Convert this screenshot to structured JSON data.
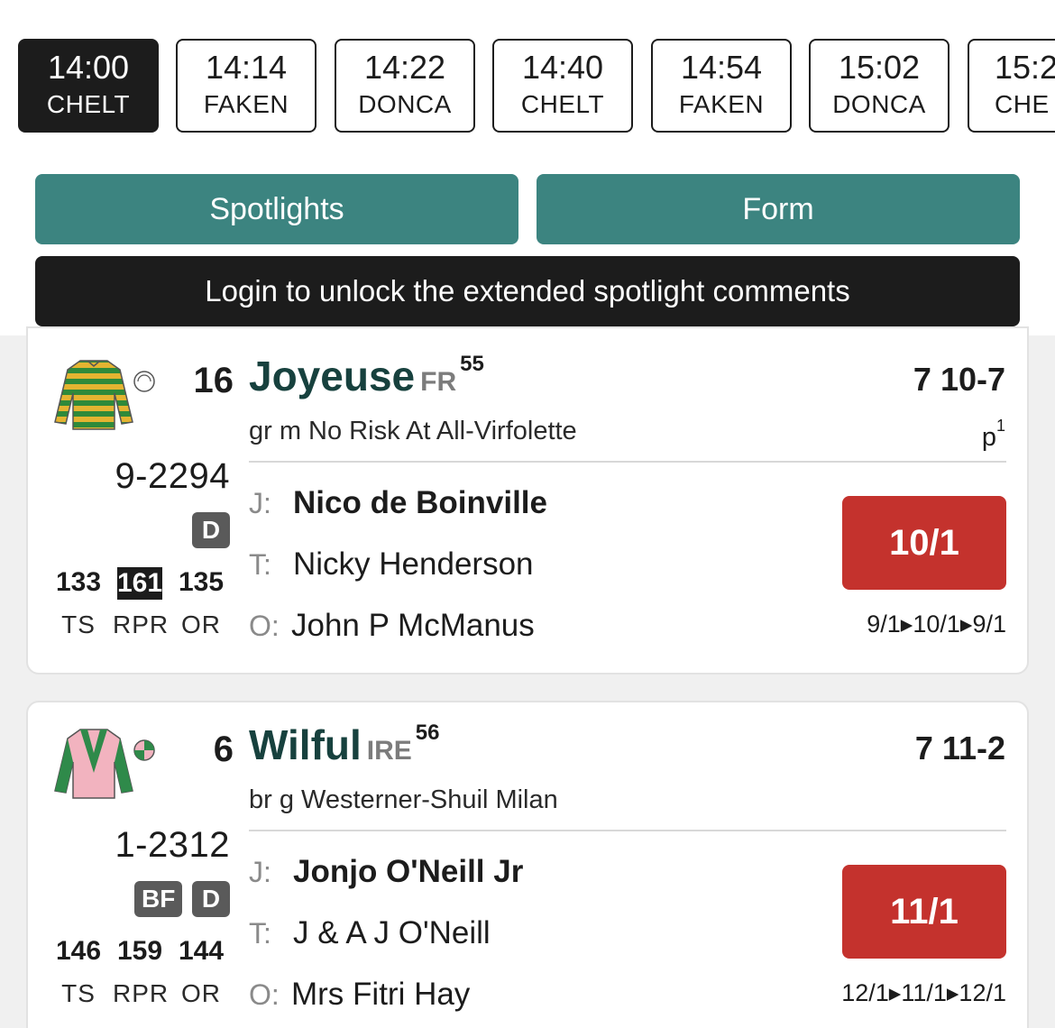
{
  "races": [
    {
      "time": "14:00",
      "course": "CHELT",
      "active": true
    },
    {
      "time": "14:14",
      "course": "FAKEN"
    },
    {
      "time": "14:22",
      "course": "DONCA"
    },
    {
      "time": "14:40",
      "course": "CHELT"
    },
    {
      "time": "14:54",
      "course": "FAKEN"
    },
    {
      "time": "15:02",
      "course": "DONCA"
    },
    {
      "time": "15:2",
      "course": "CHE"
    }
  ],
  "tabs": {
    "spotlights": "Spotlights",
    "form": "Form"
  },
  "login_banner": "Login to unlock the extended spotlight comments",
  "colors": {
    "teal": "#3c8480",
    "odds_red": "#c4322d",
    "dark": "#1c1c1c",
    "badge_grey": "#5a5a5a"
  },
  "runners": [
    {
      "cloth": "16",
      "name": "Joyeuse",
      "origin": "FR",
      "rating": "55",
      "age_weight": "7 10-7",
      "breeding": "gr m   No Risk At All-Virfolette",
      "headgear": "p",
      "headgear_sup": "1",
      "form": "9-2294",
      "badges": [
        "D"
      ],
      "ts": "133",
      "rpr": "161",
      "or": "135",
      "ts_label": "TS",
      "rpr_label": "RPR",
      "or_label": "OR",
      "j_label": "J:",
      "t_label": "T:",
      "o_label": "O:",
      "jockey": "Nico de Boinville",
      "trainer": "Nicky Henderson",
      "owner": "John P McManus",
      "odds": "10/1",
      "odds_history": "9/1▸10/1▸9/1",
      "silks_icon": "green-gold-hooped-silks-icon",
      "cap_icon": "white-cap-icon"
    },
    {
      "cloth": "6",
      "name": "Wilful",
      "origin": "IRE",
      "rating": "56",
      "age_weight": "7 11-2",
      "breeding": "br g   Westerner-Shuil Milan",
      "form": "1-2312",
      "badges": [
        "BF",
        "D"
      ],
      "ts": "146",
      "rpr": "159",
      "or": "144",
      "ts_label": "TS",
      "rpr_label": "RPR",
      "or_label": "OR",
      "j_label": "J:",
      "t_label": "T:",
      "o_label": "O:",
      "jockey": "Jonjo O'Neill Jr",
      "trainer": "J & A J O'Neill",
      "owner": "Mrs Fitri Hay",
      "odds": "11/1",
      "odds_history": "12/1▸11/1▸12/1",
      "silks_icon": "pink-green-chevron-silks-icon",
      "cap_icon": "quartered-cap-icon"
    }
  ]
}
